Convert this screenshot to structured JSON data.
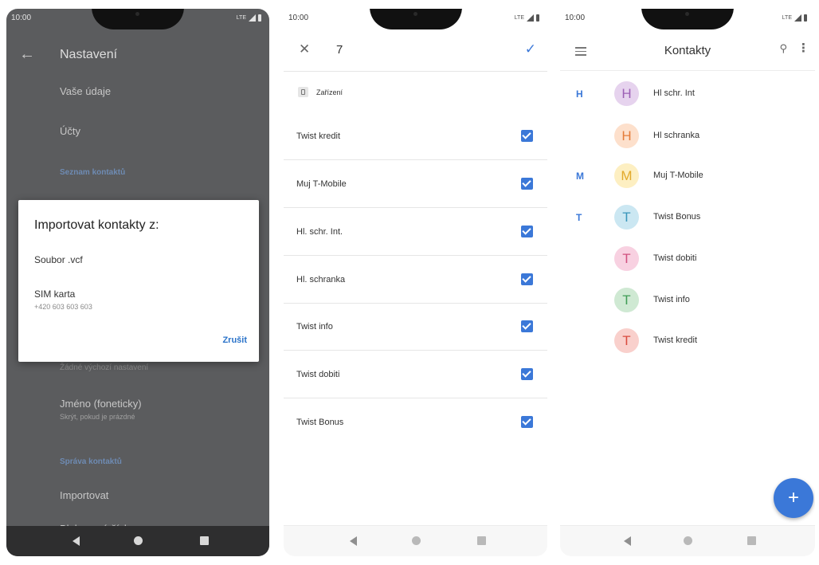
{
  "phone1": {
    "status": {
      "time": "10:00",
      "network": "LTE"
    },
    "header": {
      "back_icon": "arrow-left-icon",
      "title": "Nastavení"
    },
    "items": {
      "your_info": "Vaše údaje",
      "accounts": "Účty",
      "section_contacts_list": "Seznam kontaktů",
      "no_default": "Žádné výchozí nastavení",
      "phonetic_name": "Jméno (foneticky)",
      "phonetic_sub": "Skrýt, pokud je prázdné",
      "section_manage": "Správa kontaktů",
      "import": "Importovat",
      "blocked": "Blokovaná čísla"
    },
    "dialog": {
      "title": "Importovat kontakty z:",
      "option_vcf": "Soubor .vcf",
      "option_sim": "SIM karta",
      "sim_number": "+420 603 603 603",
      "cancel": "Zrušit"
    }
  },
  "phone2": {
    "status": {
      "time": "10:00",
      "network": "LTE"
    },
    "header": {
      "close_icon": "close-icon",
      "count": "7",
      "confirm_icon": "check-icon"
    },
    "account": {
      "icon": "phone-device-icon",
      "label": "Zařízení"
    },
    "contacts": [
      {
        "name": "Twist kredit",
        "checked": true
      },
      {
        "name": "Muj T-Mobile",
        "checked": true
      },
      {
        "name": "Hl. schr. Int.",
        "checked": true
      },
      {
        "name": "Hl. schranka",
        "checked": true
      },
      {
        "name": "Twist info",
        "checked": true
      },
      {
        "name": "Twist dobiti",
        "checked": true
      },
      {
        "name": "Twist Bonus",
        "checked": true
      }
    ]
  },
  "phone3": {
    "status": {
      "time": "10:00",
      "network": "LTE"
    },
    "header": {
      "menu_icon": "hamburger-menu-icon",
      "title": "Kontakty",
      "search_icon": "search-icon",
      "more_icon": "more-vert-icon"
    },
    "letters": [
      "H",
      "M",
      "T"
    ],
    "contacts": [
      {
        "initial": "H",
        "name": "Hl schr. Int",
        "bg": "#e6d3ee",
        "fg": "#9c5fb5"
      },
      {
        "initial": "H",
        "name": "Hl schranka",
        "bg": "#fde0cc",
        "fg": "#e57c3a"
      },
      {
        "initial": "M",
        "name": "Muj T-Mobile",
        "bg": "#fdefc2",
        "fg": "#e2a92b"
      },
      {
        "initial": "T",
        "name": "Twist Bonus",
        "bg": "#cbe7f2",
        "fg": "#3996ba"
      },
      {
        "initial": "T",
        "name": "Twist dobiti",
        "bg": "#f8d1e1",
        "fg": "#d0517f"
      },
      {
        "initial": "T",
        "name": "Twist info",
        "bg": "#cfe9d3",
        "fg": "#3f9d55"
      },
      {
        "initial": "T",
        "name": "Twist kredit",
        "bg": "#f9d0cc",
        "fg": "#d94b3f"
      }
    ],
    "fab": "+",
    "colors": {
      "accent": "#3b78d8"
    }
  }
}
